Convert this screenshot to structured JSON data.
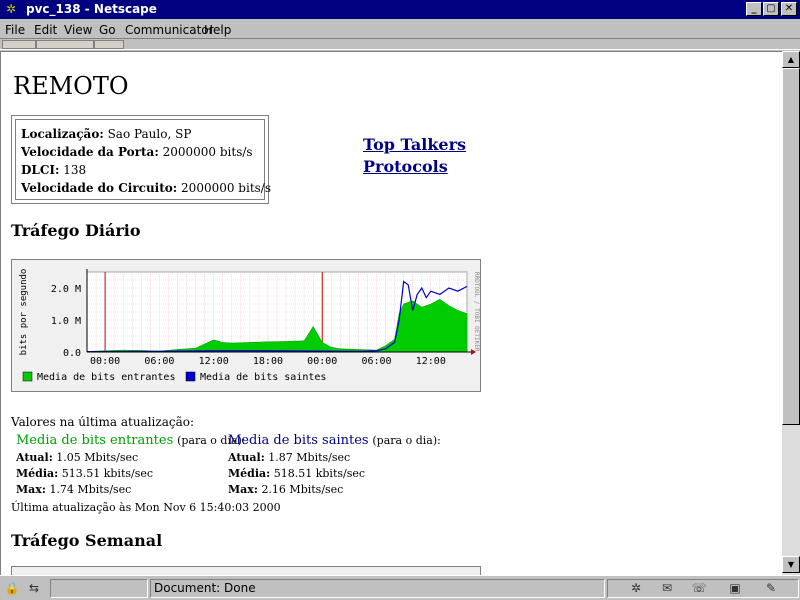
{
  "window": {
    "title": "pvc_138 - Netscape",
    "controls": {
      "minimize": "_",
      "maximize": "▢",
      "close": "✕"
    }
  },
  "menu": [
    {
      "label": "File",
      "accel": "F"
    },
    {
      "label": "Edit",
      "accel": "E"
    },
    {
      "label": "View",
      "accel": "V"
    },
    {
      "label": "Go",
      "accel": "G"
    },
    {
      "label": "Communicator",
      "accel": "C"
    },
    {
      "label": "Help",
      "accel": "H"
    }
  ],
  "page": {
    "heading": "REMOTO",
    "info": {
      "localizacao_label": "Localização:",
      "localizacao_value": "Sao Paulo, SP",
      "porta_label": "Velocidade da Porta:",
      "porta_value": "2000000 bits/s",
      "dlci_label": "DLCI:",
      "dlci_value": "138",
      "circuito_label": "Velocidade do Circuito:",
      "circuito_value": "2000000 bits/s"
    },
    "links": {
      "top_talkers": "Top Talkers",
      "protocols": "Protocols"
    },
    "daily_heading": "Tráfego Diário",
    "weekly_heading": "Tráfego Semanal",
    "values_intro": "Valores na última atualização:",
    "incoming": {
      "title": "Media de bits entrantes",
      "suffix": "(para o dia):",
      "atual_label": "Atual:",
      "atual": "1.05 Mbits/sec",
      "media_label": "Média:",
      "media": "513.51 kbits/sec",
      "max_label": "Max:",
      "max": "1.74 Mbits/sec"
    },
    "outgoing": {
      "title": "Media de bits saintes",
      "suffix": "(para o dia):",
      "atual_label": "Atual:",
      "atual": "1.87 Mbits/sec",
      "media_label": "Média:",
      "media": "518.51 kbits/sec",
      "max_label": "Max:",
      "max": "2.16 Mbits/sec"
    },
    "last_update": "Última atualização às Mon Nov 6 15:40:03 2000"
  },
  "chart_data": {
    "type": "area",
    "ylabel": "bits por segundo",
    "side_label": "RRDTOOL / TOBI OETIKER",
    "y_ticks": [
      "0.0",
      "1.0 M",
      "2.0 M"
    ],
    "ylim": [
      0,
      2500000
    ],
    "x_ticks": [
      "00:00",
      "06:00",
      "12:00",
      "18:00",
      "00:00",
      "06:00",
      "12:00"
    ],
    "x_tick_hours": [
      0,
      6,
      12,
      18,
      24,
      30,
      36
    ],
    "xlim_hours": [
      -2,
      40
    ],
    "day_boundaries_hours": [
      0,
      24
    ],
    "grid": true,
    "legend_position": "bottom",
    "series": [
      {
        "name": "Media de bits entrantes",
        "color": "#00cc00",
        "x_hours": [
          -2,
          0,
          2,
          4,
          6,
          8,
          10,
          11,
          12,
          13,
          14,
          16,
          18,
          20,
          22,
          23,
          24,
          25,
          26,
          28,
          30,
          31,
          32,
          32.5,
          33,
          34,
          35,
          36,
          37,
          38,
          39,
          40
        ],
        "values": [
          20000,
          40000,
          60000,
          50000,
          30000,
          80000,
          120000,
          250000,
          380000,
          300000,
          280000,
          300000,
          320000,
          330000,
          350000,
          800000,
          300000,
          150000,
          100000,
          80000,
          60000,
          200000,
          400000,
          1200000,
          1500000,
          1600000,
          1400000,
          1500000,
          1650000,
          1450000,
          1300000,
          1200000
        ]
      },
      {
        "name": "Media de bits saintes",
        "color": "#0000cc",
        "x_hours": [
          -2,
          6,
          12,
          18,
          24,
          28,
          30,
          31,
          32,
          32.5,
          33,
          33.5,
          34,
          34.5,
          35,
          35.5,
          36,
          37,
          38,
          39,
          40
        ],
        "values": [
          10000,
          20000,
          40000,
          40000,
          30000,
          20000,
          40000,
          100000,
          300000,
          1000000,
          2200000,
          2100000,
          1300000,
          1800000,
          2000000,
          1700000,
          1900000,
          1800000,
          2000000,
          1900000,
          2050000
        ]
      }
    ]
  },
  "status": {
    "text": "Document: Done"
  }
}
